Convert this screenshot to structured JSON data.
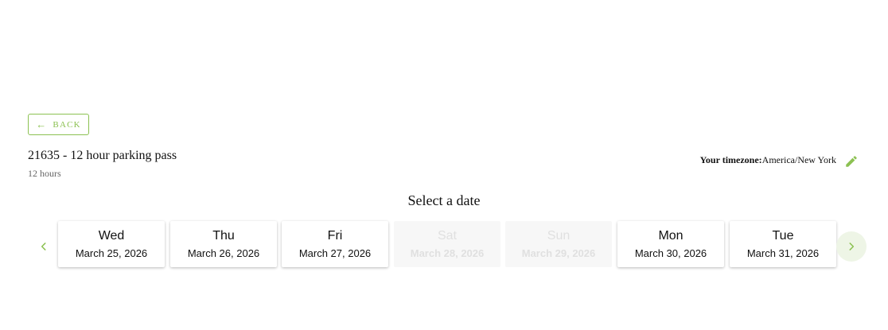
{
  "back": {
    "label": "BACK",
    "icon": "arrow-left-icon"
  },
  "product": {
    "title": "21635 - 12 hour parking pass",
    "duration": "12 hours"
  },
  "timezone": {
    "label": "Your timezone:",
    "value": "America/New York",
    "edit_icon": "pencil-icon"
  },
  "select_date_label": "Select a date",
  "nav": {
    "prev_icon": "chevron-left-icon",
    "next_icon": "chevron-right-icon"
  },
  "colors": {
    "accent": "#8cc152",
    "next_bg": "#eef5e6",
    "disabled_bg": "#f7f7f7"
  },
  "days": [
    {
      "dow": "Wed",
      "date": "March 25, 2026",
      "available": true
    },
    {
      "dow": "Thu",
      "date": "March 26, 2026",
      "available": true
    },
    {
      "dow": "Fri",
      "date": "March 27, 2026",
      "available": true
    },
    {
      "dow": "Sat",
      "date": "March 28, 2026",
      "available": false
    },
    {
      "dow": "Sun",
      "date": "March 29, 2026",
      "available": false
    },
    {
      "dow": "Mon",
      "date": "March 30, 2026",
      "available": true
    },
    {
      "dow": "Tue",
      "date": "March 31, 2026",
      "available": true
    }
  ]
}
